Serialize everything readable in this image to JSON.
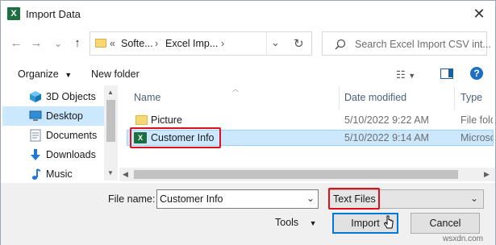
{
  "window": {
    "title": "Import Data",
    "app_icon": "X"
  },
  "nav": {
    "back": "←",
    "forward": "→",
    "recent": "⌄",
    "up": "↑",
    "refresh": "↻",
    "breadcrumb": [
      "«",
      "Softe...",
      "›",
      "Excel Imp...",
      "›"
    ],
    "search_placeholder": "Search Excel Import CSV int..."
  },
  "toolbar": {
    "organize": "Organize",
    "new_folder": "New folder"
  },
  "sidebar": {
    "items": [
      {
        "label": "3D Objects",
        "icon": "3d-objects-icon"
      },
      {
        "label": "Desktop",
        "icon": "desktop-icon",
        "selected": true
      },
      {
        "label": "Documents",
        "icon": "documents-icon"
      },
      {
        "label": "Downloads",
        "icon": "downloads-icon"
      },
      {
        "label": "Music",
        "icon": "music-icon"
      }
    ]
  },
  "columns": {
    "name": "Name",
    "date": "Date modified",
    "type": "Type"
  },
  "files": [
    {
      "name": "Picture",
      "date": "5/10/2022 9:22 AM",
      "type": "File fold",
      "icon": "folder-icon"
    },
    {
      "name": "Customer Info",
      "date": "5/10/2022 9:14 AM",
      "type": "Microso",
      "icon": "excel-file-icon",
      "selected": true
    }
  ],
  "footer": {
    "file_name_label": "File name:",
    "file_name_value": "Customer Info",
    "filter_value": "Text Files",
    "tools": "Tools",
    "import": "Import",
    "cancel": "Cancel"
  },
  "watermark": "wsxdn.com",
  "colors": {
    "selection": "#cce8ff",
    "highlight_box": "#e0101a",
    "excel_green": "#1d6f42",
    "primary_border": "#0078d7"
  }
}
